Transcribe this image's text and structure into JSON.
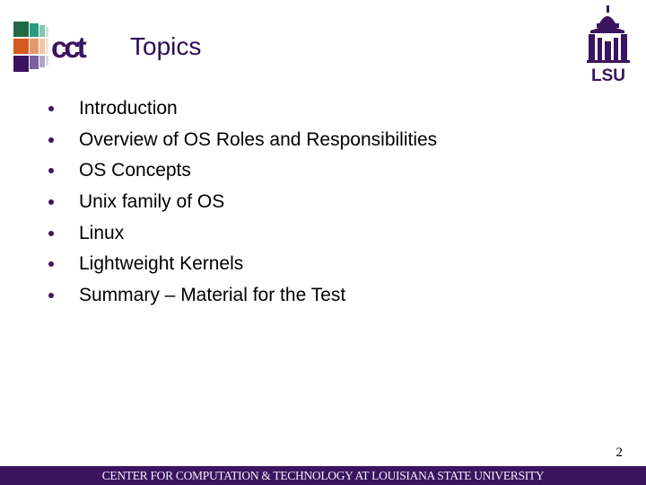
{
  "header": {
    "title": "Topics",
    "left_logo": "cct-logo",
    "right_logo": "lsu-logo",
    "left_logo_text": "cct",
    "right_logo_text": "LSU"
  },
  "colors": {
    "purple": "#3a145f",
    "title": "#2e0b56",
    "green": "#1f6b45",
    "teal": "#2a9a80",
    "orange": "#d65a1e",
    "peach": "#e39a6a"
  },
  "bullets": [
    {
      "label": "Introduction"
    },
    {
      "label": "Overview of OS Roles and Responsibilities"
    },
    {
      "label": "OS Concepts"
    },
    {
      "label": "Unix family of OS"
    },
    {
      "label": "Linux"
    },
    {
      "label": "Lightweight Kernels"
    },
    {
      "label": "Summary – Material for the Test"
    }
  ],
  "page_number": "2",
  "footer": {
    "text": "CENTER FOR COMPUTATION & TECHNOLOGY AT LOUISIANA STATE UNIVERSITY"
  }
}
